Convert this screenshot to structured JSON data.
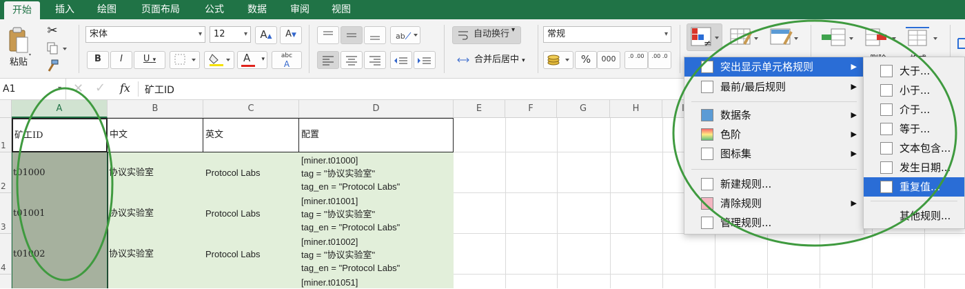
{
  "tabs": [
    "开始",
    "插入",
    "绘图",
    "页面布局",
    "公式",
    "数据",
    "审阅",
    "视图"
  ],
  "clipboard": {
    "paste_label": "粘贴"
  },
  "font": {
    "name": "宋体",
    "size": "12",
    "bold": "B",
    "italic": "I",
    "underline": "U",
    "font_color_glyph": "A",
    "phonetic_glyph": "abc"
  },
  "alignment": {
    "wrap_text": "自动换行",
    "merge_center": "合并后居中"
  },
  "number": {
    "format": "常规",
    "percent": "%",
    "thousands": "000",
    "inc_decimal": ".0 .00",
    "dec_decimal": ".00 .0"
  },
  "ribbon_partial_labels": {
    "delete": "删除",
    "format": "格式"
  },
  "formula_bar": {
    "name_box": "A1",
    "fx": "fx",
    "content": "矿工ID"
  },
  "columns": [
    "A",
    "B",
    "C",
    "D",
    "E",
    "F",
    "G",
    "H",
    "I"
  ],
  "rows": [
    "1",
    "2",
    "3",
    "4"
  ],
  "table": {
    "headers": [
      "矿工ID",
      "中文",
      "英文",
      "配置"
    ],
    "rows": [
      {
        "id": "t01000",
        "cn": "协议实验室",
        "en": "Protocol Labs",
        "cfg": [
          "[miner.t01000]",
          "tag = \"协议实验室\"",
          "tag_en = \"Protocol Labs\""
        ]
      },
      {
        "id": "t01001",
        "cn": "协议实验室",
        "en": "Protocol Labs",
        "cfg": [
          "[miner.t01001]",
          "tag = \"协议实验室\"",
          "tag_en = \"Protocol Labs\""
        ]
      },
      {
        "id": "t01002",
        "cn": "协议实验室",
        "en": "Protocol Labs",
        "cfg": [
          "[miner.t01002]",
          "tag = \"协议实验室\"",
          "tag_en = \"Protocol Labs\""
        ]
      }
    ],
    "partial_row": {
      "cfg": "[miner.t01051]"
    }
  },
  "cf_menu": {
    "items": [
      {
        "label": "突出显示单元格规则",
        "icon": "highlight-rules-icon",
        "submenu": true,
        "highlighted": true
      },
      {
        "label": "最前/最后规则",
        "icon": "top-bottom-rules-icon",
        "submenu": true
      },
      {
        "label": "数据条",
        "icon": "data-bars-icon",
        "submenu": true
      },
      {
        "label": "色阶",
        "icon": "color-scales-icon",
        "submenu": true
      },
      {
        "label": "图标集",
        "icon": "icon-sets-icon",
        "submenu": true
      },
      {
        "label": "新建规则...",
        "icon": "new-rule-icon",
        "submenu": false
      },
      {
        "label": "清除规则",
        "icon": "clear-rules-icon",
        "submenu": true
      },
      {
        "label": "管理规则...",
        "icon": "manage-rules-icon",
        "submenu": false
      }
    ]
  },
  "highlight_submenu": {
    "items": [
      {
        "label": "大于...",
        "icon": "greater-than-icon"
      },
      {
        "label": "小于...",
        "icon": "less-than-icon"
      },
      {
        "label": "介于...",
        "icon": "between-icon"
      },
      {
        "label": "等于...",
        "icon": "equal-to-icon"
      },
      {
        "label": "文本包含...",
        "icon": "text-contains-icon"
      },
      {
        "label": "发生日期...",
        "icon": "date-occurring-icon"
      },
      {
        "label": "重复值...",
        "icon": "duplicate-values-icon",
        "highlighted": true
      },
      {
        "label": "其他规则...",
        "icon": "",
        "highlighted": false
      }
    ]
  },
  "colors": {
    "ribbon_tab_bg": "#207346",
    "table_fill": "#e2efda",
    "selected_col_fill": "#a6b19e",
    "menu_highlight": "#2a6dd6",
    "annotation_circle": "#3f9a3f"
  }
}
